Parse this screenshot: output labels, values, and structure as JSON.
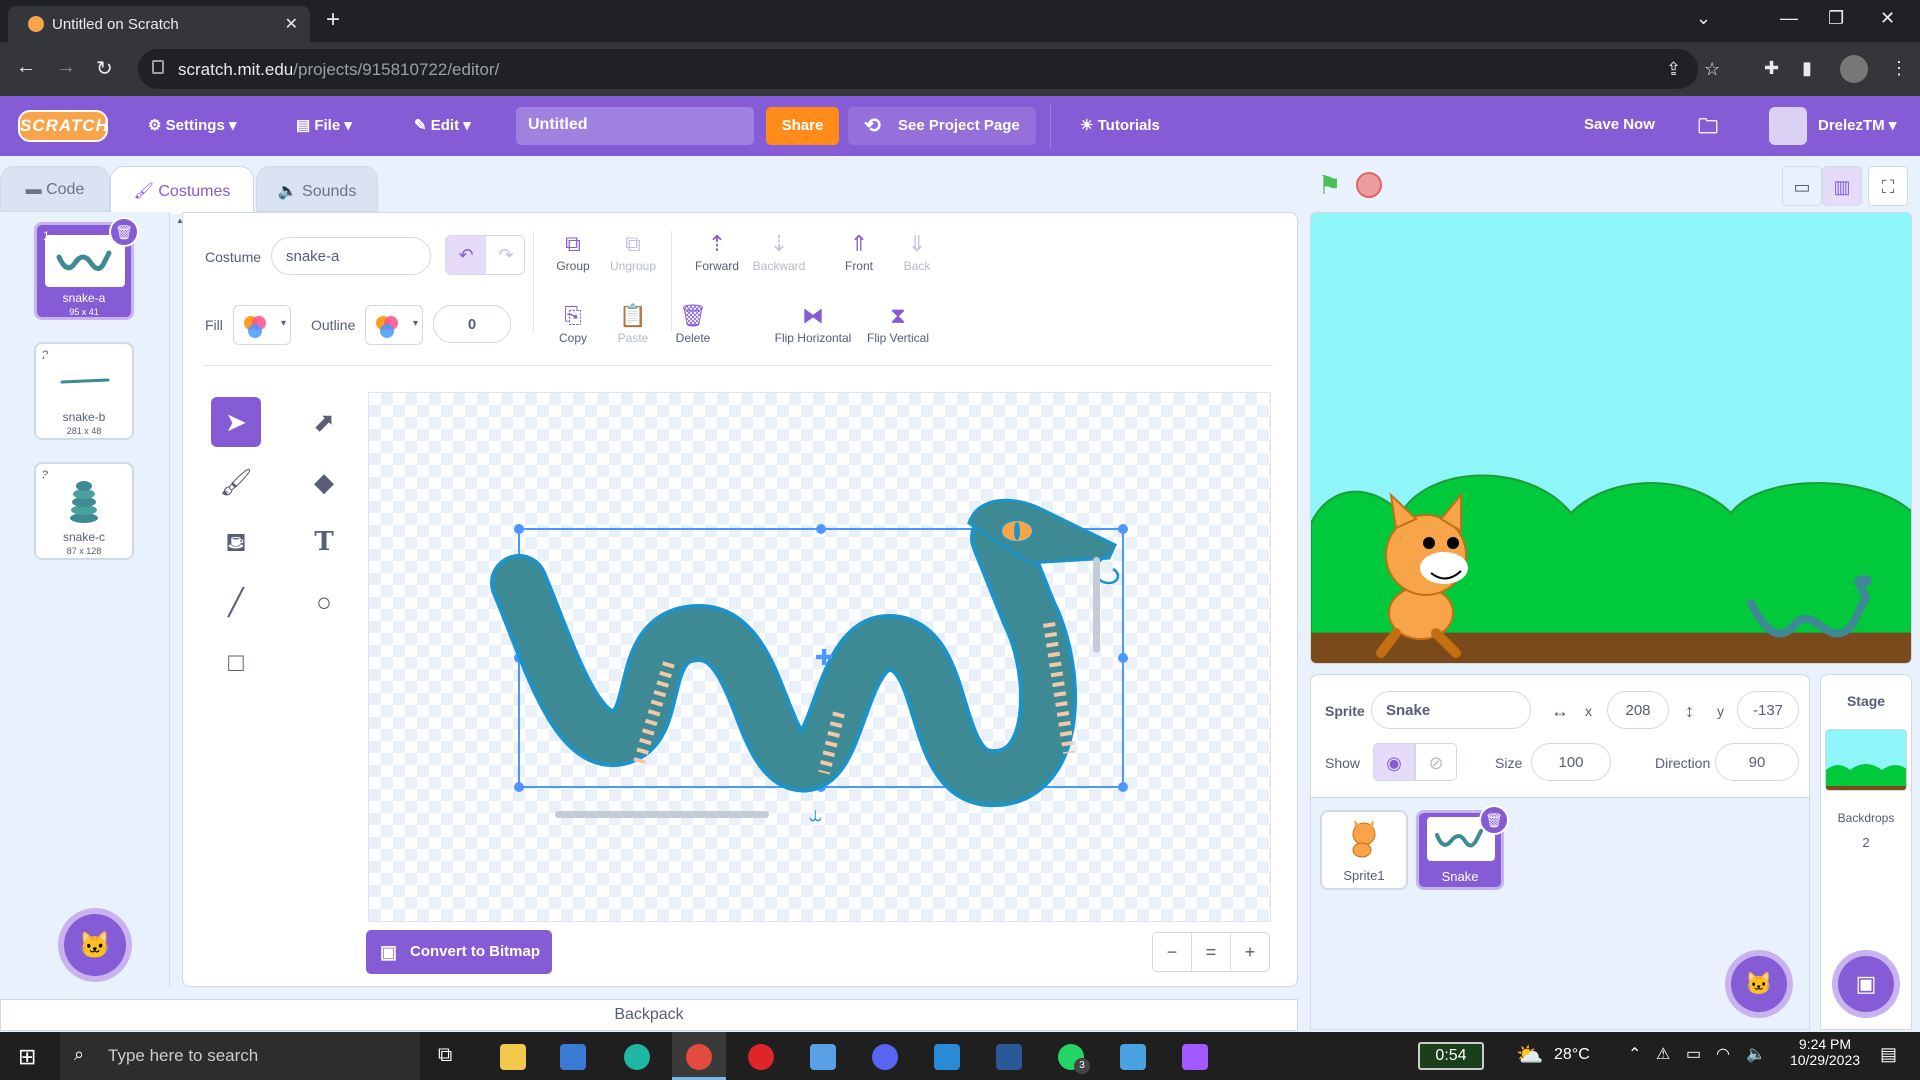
{
  "browser": {
    "tab_title": "Untitled on Scratch",
    "url_domain": "scratch.mit.edu",
    "url_path": "/projects/915810722/editor/"
  },
  "menubar": {
    "logo": "SCRATCH",
    "settings": "Settings",
    "file": "File",
    "edit": "Edit",
    "project_title": "Untitled",
    "share": "Share",
    "see_project_page": "See Project Page",
    "tutorials": "Tutorials",
    "save_now": "Save Now",
    "username": "DrelezTM"
  },
  "tabs": {
    "code": "Code",
    "costumes": "Costumes",
    "sounds": "Sounds"
  },
  "costumes": [
    {
      "num": "1",
      "name": "snake-a",
      "dims": "95 x 41"
    },
    {
      "num": "2",
      "name": "snake-b",
      "dims": "281 x 48"
    },
    {
      "num": "3",
      "name": "snake-c",
      "dims": "87 x 128"
    }
  ],
  "paint": {
    "costume_label": "Costume",
    "costume_name": "snake-a",
    "fill_label": "Fill",
    "outline_label": "Outline",
    "outline_width": "0",
    "group": "Group",
    "ungroup": "Ungroup",
    "forward": "Forward",
    "backward": "Backward",
    "front": "Front",
    "back": "Back",
    "copy": "Copy",
    "paste": "Paste",
    "delete": "Delete",
    "flip_horizontal": "Flip Horizontal",
    "flip_vertical": "Flip Vertical",
    "convert_to_bitmap": "Convert to Bitmap",
    "zoom_out": "−",
    "zoom_reset": "=",
    "zoom_in": "+"
  },
  "sprite_info": {
    "sprite_label": "Sprite",
    "sprite_name": "Snake",
    "x_label": "x",
    "x_value": "208",
    "y_label": "y",
    "y_value": "-137",
    "show_label": "Show",
    "size_label": "Size",
    "size_value": "100",
    "direction_label": "Direction",
    "direction_value": "90"
  },
  "sprites": [
    {
      "name": "Sprite1"
    },
    {
      "name": "Snake"
    }
  ],
  "stage_panel": {
    "title": "Stage",
    "backdrops_label": "Backdrops",
    "backdrops_count": "2"
  },
  "backpack": "Backpack",
  "taskbar": {
    "search_placeholder": "Type here to search",
    "battery_timer": "0:54",
    "temperature": "28°C",
    "time": "9:24 PM",
    "date": "10/29/2023",
    "whatsapp_badge": "3"
  },
  "colors": {
    "scratch_purple": "#855cd6",
    "share_orange": "#ff8c1a",
    "snake_teal": "#3d8a94",
    "stage_sky": "#8ef6f8",
    "stage_grass": "#00c93b"
  }
}
